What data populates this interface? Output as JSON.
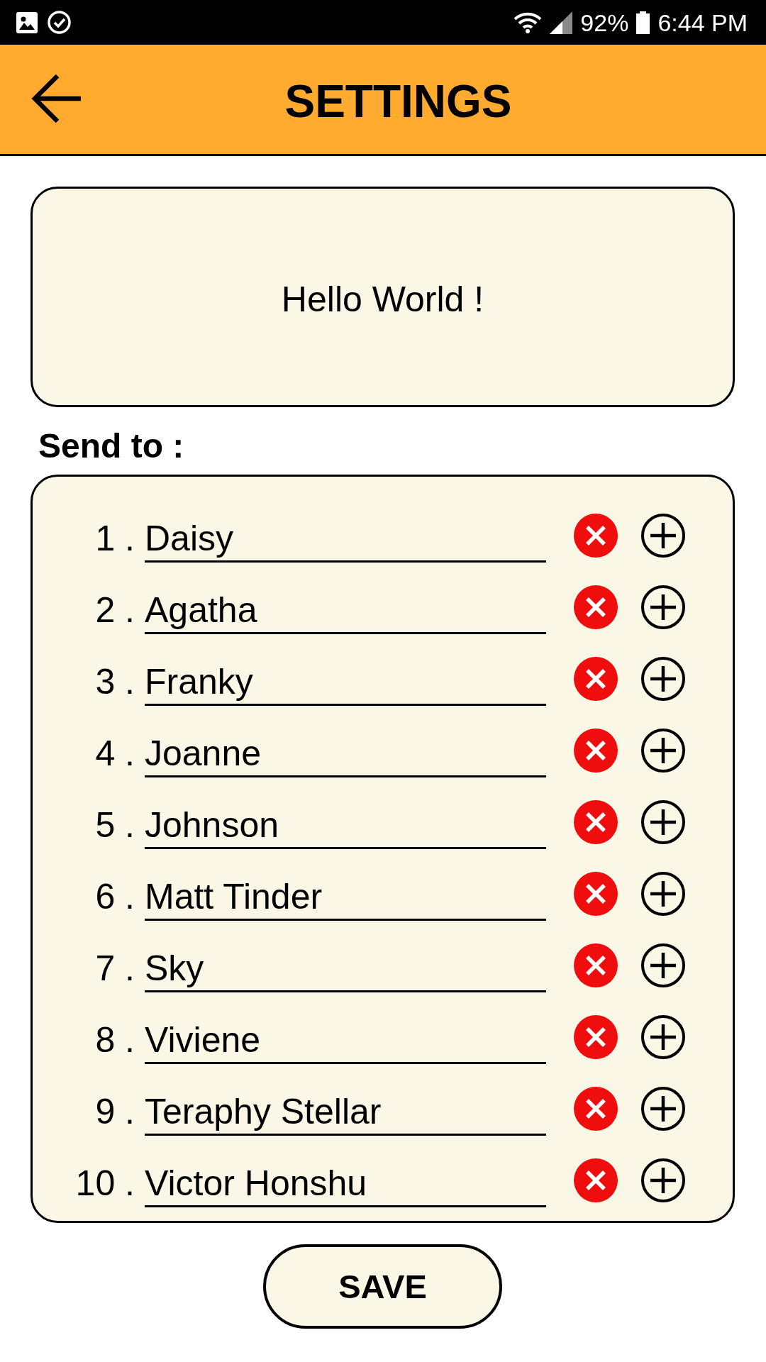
{
  "status_bar": {
    "battery": "92%",
    "time": "6:44 PM"
  },
  "header": {
    "title": "SETTINGS"
  },
  "message": {
    "text": "Hello World !"
  },
  "recipients": {
    "label": "Send to :",
    "items": [
      {
        "number": "1 .",
        "name": "Daisy"
      },
      {
        "number": "2 .",
        "name": "Agatha"
      },
      {
        "number": "3 .",
        "name": "Franky"
      },
      {
        "number": "4 .",
        "name": "Joanne"
      },
      {
        "number": "5 .",
        "name": "Johnson"
      },
      {
        "number": "6 .",
        "name": "Matt Tinder"
      },
      {
        "number": "7 .",
        "name": "Sky"
      },
      {
        "number": "8 .",
        "name": "Viviene"
      },
      {
        "number": "9 .",
        "name": "Teraphy Stellar"
      },
      {
        "number": "10 .",
        "name": "Victor Honshu"
      }
    ]
  },
  "save_button": {
    "label": "SAVE"
  }
}
